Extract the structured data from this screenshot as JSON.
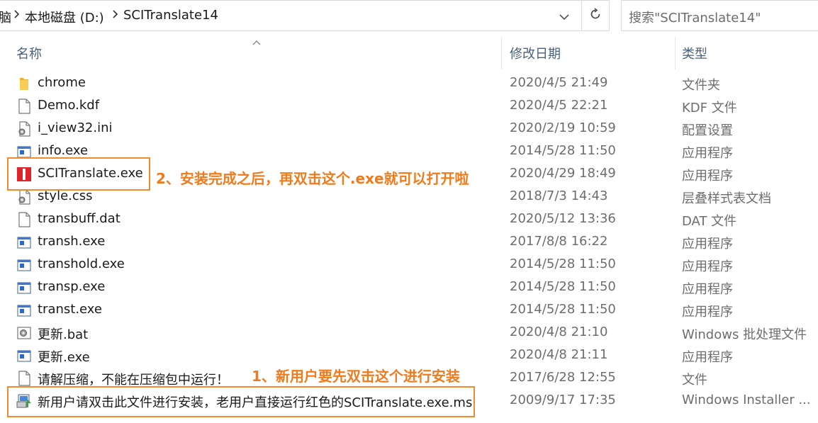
{
  "address": {
    "crumb_partial": "脑",
    "crumb_drive": "本地磁盘 (D:)",
    "crumb_folder": "SCITranslate14",
    "search_placeholder": "搜索\"SCITranslate14\""
  },
  "columns": {
    "name": "名称",
    "date": "修改日期",
    "type": "类型"
  },
  "files": [
    {
      "name": "chrome",
      "date": "2020/4/5 21:49",
      "type": "文件夹",
      "icon": "folder-icon"
    },
    {
      "name": "Demo.kdf",
      "date": "2020/4/5 22:21",
      "type": "KDF 文件",
      "icon": "file-icon"
    },
    {
      "name": "i_view32.ini",
      "date": "2020/2/19 10:59",
      "type": "配置设置",
      "icon": "config-file-icon"
    },
    {
      "name": "info.exe",
      "date": "2014/5/28 11:50",
      "type": "应用程序",
      "icon": "exe-icon"
    },
    {
      "name": "SCITranslate.exe",
      "date": "2020/4/29 18:49",
      "type": "应用程序",
      "icon": "red-app-icon"
    },
    {
      "name": "style.css",
      "date": "2018/7/3 14:43",
      "type": "层叠样式表文档",
      "icon": "css-file-icon"
    },
    {
      "name": "transbuff.dat",
      "date": "2020/5/12 13:36",
      "type": "DAT 文件",
      "icon": "file-icon"
    },
    {
      "name": "transh.exe",
      "date": "2017/8/8 16:22",
      "type": "应用程序",
      "icon": "exe-icon"
    },
    {
      "name": "transhold.exe",
      "date": "2014/5/28 11:50",
      "type": "应用程序",
      "icon": "exe-icon"
    },
    {
      "name": "transp.exe",
      "date": "2014/5/28 11:50",
      "type": "应用程序",
      "icon": "exe-icon"
    },
    {
      "name": "transt.exe",
      "date": "2014/5/28 11:50",
      "type": "应用程序",
      "icon": "exe-icon"
    },
    {
      "name": "更新.bat",
      "date": "2020/4/8 21:10",
      "type": "Windows 批处理文件",
      "icon": "batch-file-icon"
    },
    {
      "name": "更新.exe",
      "date": "2020/4/8 21:11",
      "type": "应用程序",
      "icon": "exe-icon"
    },
    {
      "name": "请解压缩，不能在压缩包中运行！",
      "date": "2017/6/28 12:55",
      "type": "文件",
      "icon": "file-icon"
    },
    {
      "name": "新用户请双击此文件进行安装，老用户直接运行红色的SCITranslate.exe.msi",
      "date": "2009/9/17 17:35",
      "type": "Windows Installer ...",
      "icon": "installer-icon"
    }
  ],
  "annotations": {
    "step1": "1、新用户要先双击这个进行安装",
    "step2": "2、安装完成之后，再双击这个.exe就可以打开啦"
  },
  "colors": {
    "annotation": "#f07b1c",
    "header_text": "#4c607a",
    "date_text": "#6d6d6d"
  }
}
